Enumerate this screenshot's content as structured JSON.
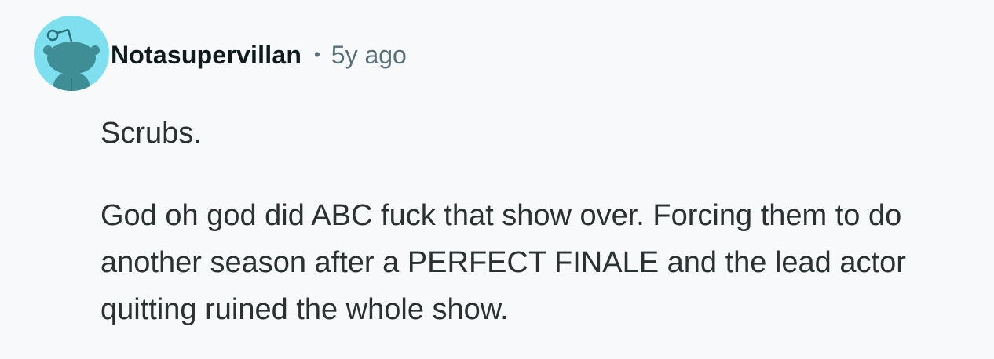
{
  "comment": {
    "author": {
      "avatar_icon": "snoo-avatar-icon",
      "avatar_color": "#7ee0ef",
      "username": "Notasupervillan"
    },
    "separator": "•",
    "timestamp": "5y ago",
    "paragraphs": [
      "Scrubs.",
      "God oh god did ABC fuck that show over. Forcing them to do another season after a PERFECT FINALE and the lead actor quitting ruined the whole show."
    ]
  }
}
